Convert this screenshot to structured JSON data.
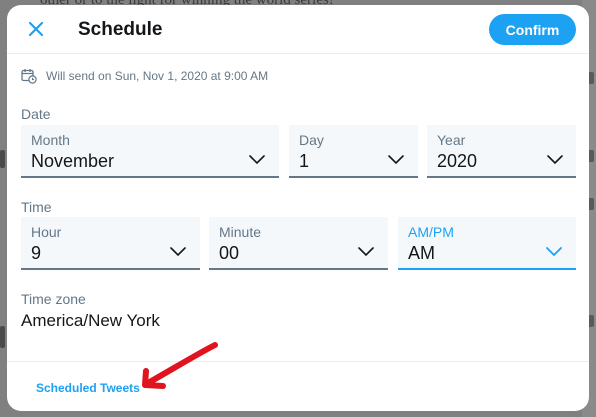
{
  "background_page": {
    "text_fragment": "other or to the light for winning the world series!"
  },
  "header": {
    "close_icon": "close-x-icon",
    "title": "Schedule",
    "confirm_label": "Confirm"
  },
  "notice": {
    "icon": "calendar-clock-icon",
    "text": "Will send on Sun, Nov 1, 2020 at 9:00 AM"
  },
  "date": {
    "section_label": "Date",
    "month": {
      "label": "Month",
      "value": "November"
    },
    "day": {
      "label": "Day",
      "value": "1"
    },
    "year": {
      "label": "Year",
      "value": "2020"
    }
  },
  "time": {
    "section_label": "Time",
    "hour": {
      "label": "Hour",
      "value": "9"
    },
    "minute": {
      "label": "Minute",
      "value": "00"
    },
    "ampm": {
      "label": "AM/PM",
      "value": "AM",
      "focused": true
    }
  },
  "timezone": {
    "label": "Time zone",
    "value": "America/New York"
  },
  "footer": {
    "scheduled_tweets_label": "Scheduled Tweets"
  },
  "annotation": {
    "icon": "red-arrow-annotation",
    "color": "#e0141e"
  },
  "colors": {
    "accent": "#1da1f2",
    "text_primary": "#14171a",
    "text_secondary": "#657786",
    "field_bg": "#f5f8fa"
  }
}
